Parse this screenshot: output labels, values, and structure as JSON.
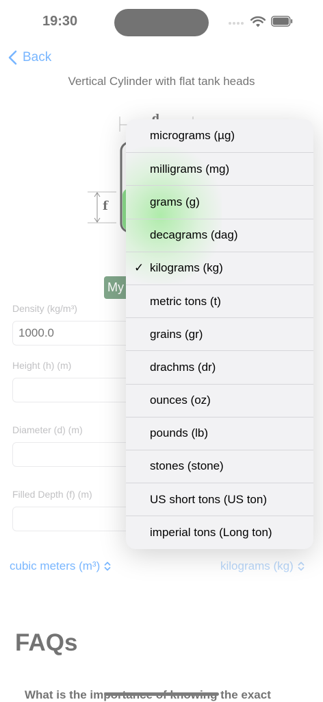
{
  "status": {
    "time": "19:30"
  },
  "nav": {
    "back_label": "Back",
    "title": "Vertical Cylinder with flat tank heads"
  },
  "diagram": {
    "label_d": "d",
    "label_f": "f"
  },
  "my_button": "My",
  "fields": [
    {
      "label": "Density (kg/m³)",
      "value": "1000.0"
    },
    {
      "label": "Height (h) (m)",
      "value": ""
    },
    {
      "label": "Diameter (d) (m)",
      "value": ""
    },
    {
      "label": "Filled Depth (f) (m)",
      "value": ""
    }
  ],
  "units": {
    "volume": "cubic meters (m³)",
    "mass": "kilograms (kg)"
  },
  "faq": {
    "heading": "FAQs",
    "question": "What is the importance of knowing the exact"
  },
  "menu": {
    "selected_index": 4,
    "items": [
      "micrograms (µg)",
      "milligrams (mg)",
      "grams (g)",
      "decagrams (dag)",
      "kilograms (kg)",
      "metric tons (t)",
      "grains (gr)",
      "drachms (dr)",
      "ounces (oz)",
      "pounds (lb)",
      "stones (stone)",
      "US short tons (US ton)",
      "imperial tons (Long ton)"
    ]
  }
}
